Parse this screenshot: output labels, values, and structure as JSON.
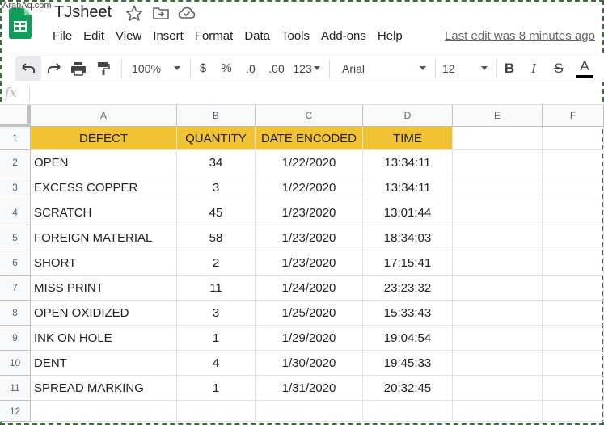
{
  "watermark": "ArabAq.com",
  "app": {
    "title": "TJsheet",
    "last_edit": "Last edit was 8 minutes ago"
  },
  "menu": [
    "File",
    "Edit",
    "View",
    "Insert",
    "Format",
    "Data",
    "Tools",
    "Add-ons",
    "Help"
  ],
  "toolbar": {
    "zoom": "100%",
    "currency": "$",
    "percent": "%",
    "decrease_decimal": ".0",
    "increase_decimal": ".00",
    "more_formats": "123",
    "font": "Arial",
    "font_size": "12",
    "bold": "B",
    "italic": "I",
    "strikethrough": "S",
    "text_color": "A"
  },
  "formula_bar": {
    "fx": "fx",
    "value": ""
  },
  "columns": [
    "A",
    "B",
    "C",
    "D",
    "E",
    "F"
  ],
  "row_numbers": [
    "1",
    "2",
    "3",
    "4",
    "5",
    "6",
    "7",
    "8",
    "9",
    "10",
    "11",
    "12"
  ],
  "header": [
    "DEFECT",
    "QUANTITY",
    "DATE ENCODED",
    "TIME"
  ],
  "rows": [
    [
      "OPEN",
      "34",
      "1/22/2020",
      "13:34:11"
    ],
    [
      "EXCESS COPPER",
      "3",
      "1/22/2020",
      "13:34:11"
    ],
    [
      "SCRATCH",
      "45",
      "1/23/2020",
      "13:01:44"
    ],
    [
      "FOREIGN MATERIAL",
      "58",
      "1/23/2020",
      "18:34:03"
    ],
    [
      "SHORT",
      "2",
      "1/23/2020",
      "17:15:41"
    ],
    [
      "MISS PRINT",
      "11",
      "1/24/2020",
      "23:23:32"
    ],
    [
      "OPEN OXIDIZED",
      "3",
      "1/25/2020",
      "15:33:43"
    ],
    [
      "INK ON HOLE",
      "1",
      "1/29/2020",
      "19:04:54"
    ],
    [
      "DENT",
      "4",
      "1/30/2020",
      "19:45:33"
    ],
    [
      "SPREAD MARKING",
      "1",
      "1/31/2020",
      "20:32:45"
    ]
  ],
  "colors": {
    "header_fill": "#f1c232",
    "logo_green": "#0f9d58"
  }
}
